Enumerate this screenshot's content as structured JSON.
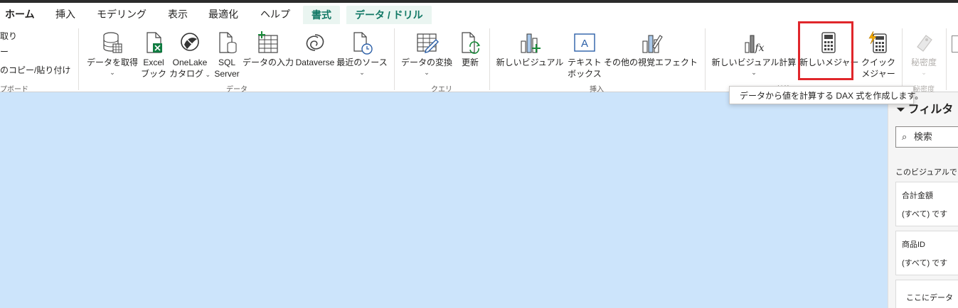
{
  "tabs": [
    {
      "label": "ホーム",
      "active": true
    },
    {
      "label": "挿入"
    },
    {
      "label": "モデリング"
    },
    {
      "label": "表示"
    },
    {
      "label": "最適化"
    },
    {
      "label": "ヘルプ"
    },
    {
      "label": "書式",
      "contextual": true
    },
    {
      "label": "データ / ドリル",
      "contextual": true
    }
  ],
  "clipboard": {
    "cut_label": "取り",
    "copy_label": "ー",
    "format_painter_label": "のコピー/貼り付け",
    "group_label": "プボード"
  },
  "data_group": {
    "get_data": "データを取得",
    "excel_line1": "Excel",
    "excel_line2": "ブック",
    "onelake_line1": "OneLake",
    "onelake_line2": "カタログ",
    "sql_line1": "SQL",
    "sql_line2": "Server",
    "enter_data": "データの入力",
    "dataverse": "Dataverse",
    "recent_sources": "最近のソース",
    "group_label": "データ"
  },
  "query_group": {
    "transform": "データの変換",
    "refresh": "更新",
    "group_label": "クエリ"
  },
  "insert_group": {
    "new_visual": "新しいビジュアル",
    "textbox_line1": "テキスト",
    "textbox_line2": "ボックス",
    "more_visuals": "その他の視覚エフェクト",
    "group_label": "挿入"
  },
  "calc_group": {
    "new_visual_calc": "新しいビジュアル計算",
    "new_measure": "新しいメジャー",
    "quick_line1": "クイック",
    "quick_line2": "メジャー",
    "group_label": "計算"
  },
  "sensitivity": {
    "label": "秘密度",
    "group_label": "秘密度"
  },
  "tooltip": {
    "text": "データから値を計算する DAX 式を作成します。"
  },
  "filter_pane": {
    "title": "フィルタ",
    "search_placeholder": "検索",
    "section": "このビジュアルで",
    "cards": [
      {
        "field": "合計金額",
        "value": "(すべて) です"
      },
      {
        "field": "商品ID",
        "value": "(すべて) です"
      }
    ],
    "drop_hint": "ここにデータ"
  },
  "colors": {
    "accent": "#117865",
    "highlight": "#e0262b",
    "canvas": "#cce4fb"
  }
}
